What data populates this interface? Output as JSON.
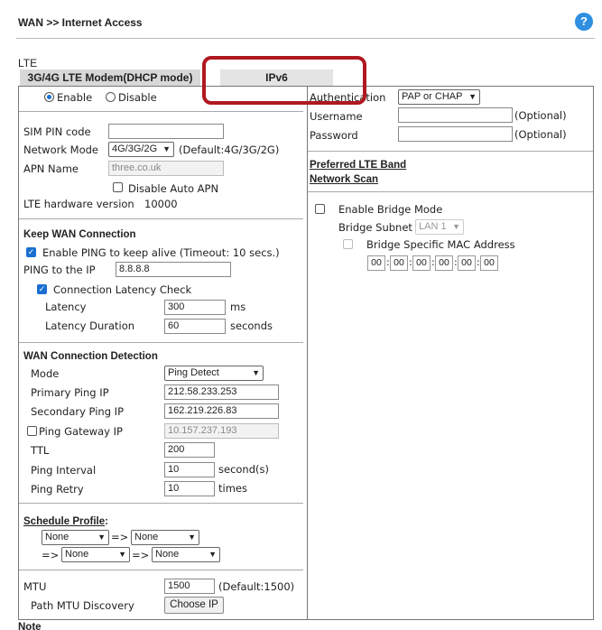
{
  "header": {
    "breadcrumb": "WAN >> Internet Access",
    "help_glyph": "?"
  },
  "section_label": "LTE",
  "tabs": [
    {
      "label": "3G/4G LTE Modem(DHCP mode)"
    },
    {
      "label": "IPv6"
    }
  ],
  "left": {
    "enable_label": "Enable",
    "disable_label": "Disable",
    "sim_pin_label": "SIM PIN code",
    "sim_pin_value": "",
    "network_mode_label": "Network Mode",
    "network_mode_value": "4G/3G/2G",
    "network_mode_default": "(Default:4G/3G/2G)",
    "apn_name_label": "APN Name",
    "apn_name_value": "three.co.uk",
    "disable_auto_apn_label": "Disable Auto APN",
    "lte_hw_label": "LTE hardware version",
    "lte_hw_value": "10000",
    "keep_wan": {
      "title": "Keep WAN Connection",
      "enable_ping_label": "Enable PING to keep alive (Timeout: 10 secs.)",
      "ping_ip_label": "PING to the IP",
      "ping_ip_value": "8.8.8.8",
      "latency_check_label": "Connection Latency Check",
      "latency_label": "Latency",
      "latency_value": "300",
      "latency_unit": "ms",
      "latency_duration_label": "Latency Duration",
      "latency_duration_value": "60",
      "latency_duration_unit": "seconds"
    },
    "detection": {
      "title": "WAN Connection Detection",
      "mode_label": "Mode",
      "mode_value": "Ping Detect",
      "primary_label": "Primary Ping IP",
      "primary_value": "212.58.233.253",
      "secondary_label": "Secondary Ping IP",
      "secondary_value": "162.219.226.83",
      "gateway_label": "Ping Gateway IP",
      "gateway_value": "10.157.237.193",
      "ttl_label": "TTL",
      "ttl_value": "200",
      "interval_label": "Ping Interval",
      "interval_value": "10",
      "interval_unit": "second(s)",
      "retry_label": "Ping Retry",
      "retry_value": "10",
      "retry_unit": "times"
    },
    "schedule": {
      "title": "Schedule Profile",
      "colon": ":",
      "arrow": "=>",
      "profiles": [
        "None",
        "None",
        "None",
        "None"
      ]
    },
    "mtu_label": "MTU",
    "mtu_value": "1500",
    "mtu_default": "(Default:1500)",
    "path_mtu_label": "Path MTU Discovery",
    "choose_ip_label": "Choose IP"
  },
  "right": {
    "auth_label": "Authentication",
    "auth_value": "PAP or CHAP",
    "username_label": "Username",
    "username_value": "",
    "username_hint": "(Optional)",
    "password_label": "Password",
    "password_value": "",
    "password_hint": "(Optional)",
    "preferred_band_link": "Preferred LTE Band",
    "network_scan_link": "Network Scan",
    "bridge_mode_label": "Enable Bridge Mode",
    "bridge_subnet_label": "Bridge Subnet",
    "bridge_subnet_value": "LAN 1",
    "bridge_mac_label": "Bridge Specific MAC Address",
    "mac_octets": [
      "00",
      "00",
      "00",
      "00",
      "00",
      "00"
    ],
    "mac_separator": ":"
  },
  "footer_partial": "Note"
}
